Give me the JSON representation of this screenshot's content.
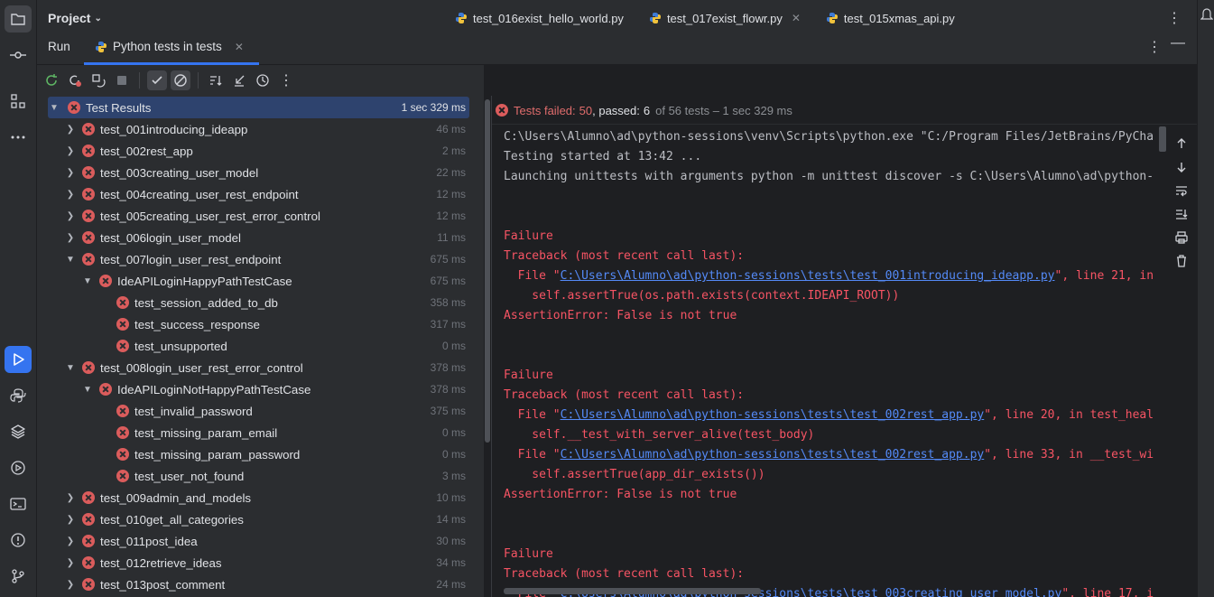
{
  "project": {
    "label": "Project"
  },
  "editor_tabs": [
    {
      "label": "test_016exist_hello_world.py"
    },
    {
      "label": "test_017exist_flowr.py"
    },
    {
      "label": "test_015xmas_api.py"
    }
  ],
  "run": {
    "title": "Run",
    "tab_label": "Python tests in tests"
  },
  "tree": [
    {
      "name": "Test Results",
      "duration": "1 sec 329 ms"
    },
    {
      "name": "test_001introducing_ideapp",
      "duration": "46 ms"
    },
    {
      "name": "test_002rest_app",
      "duration": "2 ms"
    },
    {
      "name": "test_003creating_user_model",
      "duration": "22 ms"
    },
    {
      "name": "test_004creating_user_rest_endpoint",
      "duration": "12 ms"
    },
    {
      "name": "test_005creating_user_rest_error_control",
      "duration": "12 ms"
    },
    {
      "name": "test_006login_user_model",
      "duration": "11 ms"
    },
    {
      "name": "test_007login_user_rest_endpoint",
      "duration": "675 ms"
    },
    {
      "name": "IdeAPILoginHappyPathTestCase",
      "duration": "675 ms"
    },
    {
      "name": "test_session_added_to_db",
      "duration": "358 ms"
    },
    {
      "name": "test_success_response",
      "duration": "317 ms"
    },
    {
      "name": "test_unsupported",
      "duration": "0 ms"
    },
    {
      "name": "test_008login_user_rest_error_control",
      "duration": "378 ms"
    },
    {
      "name": "IdeAPILoginNotHappyPathTestCase",
      "duration": "378 ms"
    },
    {
      "name": "test_invalid_password",
      "duration": "375 ms"
    },
    {
      "name": "test_missing_param_email",
      "duration": "0 ms"
    },
    {
      "name": "test_missing_param_password",
      "duration": "0 ms"
    },
    {
      "name": "test_user_not_found",
      "duration": "3 ms"
    },
    {
      "name": "test_009admin_and_models",
      "duration": "10 ms"
    },
    {
      "name": "test_010get_all_categories",
      "duration": "14 ms"
    },
    {
      "name": "test_011post_idea",
      "duration": "30 ms"
    },
    {
      "name": "test_012retrieve_ideas",
      "duration": "34 ms"
    },
    {
      "name": "test_013post_comment",
      "duration": "24 ms"
    }
  ],
  "status": {
    "failed_label": "Tests failed:",
    "failed_count": "50",
    "passed_label": ", passed:",
    "passed_count": "6",
    "rest": "of 56 tests – 1 sec 329 ms"
  },
  "console": {
    "line1": "C:\\Users\\Alumno\\ad\\python-sessions\\venv\\Scripts\\python.exe \"C:/Program Files/JetBrains/PyCha",
    "line2": "Testing started at 13:42 ...",
    "line3": "Launching unittests with arguments python -m unittest discover -s C:\\Users\\Alumno\\ad\\python-",
    "failure": "Failure",
    "traceback": "Traceback (most recent call last):",
    "assertion": "AssertionError: False is not true",
    "f1_file_pre": "  File \"",
    "f1_link": "C:\\Users\\Alumno\\ad\\python-sessions\\tests\\test_001introducing_ideapp.py",
    "f1_file_post": "\", line 21, in",
    "f1_code": "    self.assertTrue(os.path.exists(context.IDEAPI_ROOT))",
    "f2_link": "C:\\Users\\Alumno\\ad\\python-sessions\\tests\\test_002rest_app.py",
    "f2_post": "\", line 20, in test_heal",
    "f2_code": "    self.__test_with_server_alive(test_body)",
    "f3_link": "C:\\Users\\Alumno\\ad\\python-sessions\\tests\\test_002rest_app.py",
    "f3_post": "\", line 33, in __test_wi",
    "f3_code": "    self.assertTrue(app_dir_exists())",
    "f4_link": "C:\\Users\\Alumno\\ad\\python-sessions\\tests\\test_003creating_user_model.py",
    "f4_post": "\", line 17, i"
  },
  "colors": {
    "accent": "#3574f0",
    "fail": "#db5c5c",
    "error_text": "#f75464",
    "link": "#548af7"
  }
}
